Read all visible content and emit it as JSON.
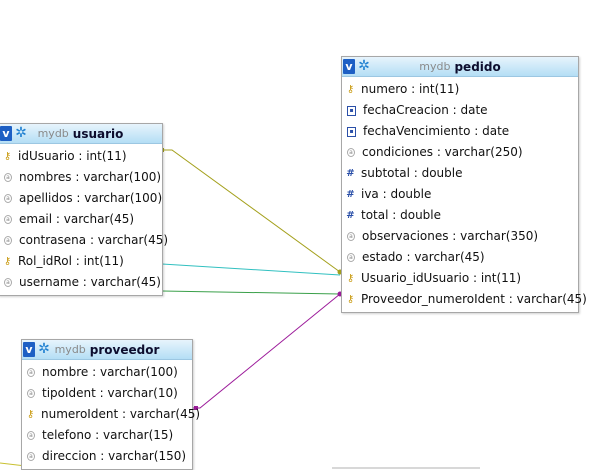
{
  "colors": {
    "link_usuario_pedido_key": "#a4a01c",
    "link_rol": "#31c0c0",
    "link_username": "#3aa04a",
    "link_proveedor": "#9c1b9a",
    "link_bottom_left": "#c8c030",
    "header_top": "#e7f4fc",
    "header_bottom": "#b4def5"
  },
  "tables": {
    "usuario": {
      "db": "mydb",
      "name": "usuario",
      "columns": [
        {
          "text": "idUsuario : int(11)",
          "icon": "primary-key-icon"
        },
        {
          "text": "nombres : varchar(100)",
          "icon": "text-field-icon"
        },
        {
          "text": "apellidos : varchar(100)",
          "icon": "text-field-icon"
        },
        {
          "text": "email : varchar(45)",
          "icon": "text-field-icon"
        },
        {
          "text": "contrasena : varchar(45)",
          "icon": "text-field-icon"
        },
        {
          "text": "Rol_idRol : int(11)",
          "icon": "primary-key-icon"
        },
        {
          "text": "username : varchar(45)",
          "icon": "text-field-icon"
        }
      ]
    },
    "pedido": {
      "db": "mydb",
      "name": "pedido",
      "columns": [
        {
          "text": "numero : int(11)",
          "icon": "primary-key-icon"
        },
        {
          "text": "fechaCreacion : date",
          "icon": "date-field-icon"
        },
        {
          "text": "fechaVencimiento : date",
          "icon": "date-field-icon"
        },
        {
          "text": "condiciones : varchar(250)",
          "icon": "text-field-icon"
        },
        {
          "text": "subtotal : double",
          "icon": "numeric-field-icon"
        },
        {
          "text": "iva : double",
          "icon": "numeric-field-icon"
        },
        {
          "text": "total : double",
          "icon": "numeric-field-icon"
        },
        {
          "text": "observaciones : varchar(350)",
          "icon": "text-field-icon"
        },
        {
          "text": "estado : varchar(45)",
          "icon": "text-field-icon"
        },
        {
          "text": "Usuario_idUsuario : int(11)",
          "icon": "primary-key-icon"
        },
        {
          "text": "Proveedor_numeroIdent : varchar(45)",
          "icon": "primary-key-icon"
        }
      ]
    },
    "proveedor": {
      "db": "mydb",
      "name": "proveedor",
      "columns": [
        {
          "text": "nombre : varchar(100)",
          "icon": "text-field-icon"
        },
        {
          "text": "tipoIdent : varchar(10)",
          "icon": "text-field-icon"
        },
        {
          "text": "numeroIdent : varchar(45)",
          "icon": "primary-key-icon"
        },
        {
          "text": "telefono : varchar(15)",
          "icon": "text-field-icon"
        },
        {
          "text": "direccion : varchar(150)",
          "icon": "text-field-icon"
        }
      ]
    }
  }
}
